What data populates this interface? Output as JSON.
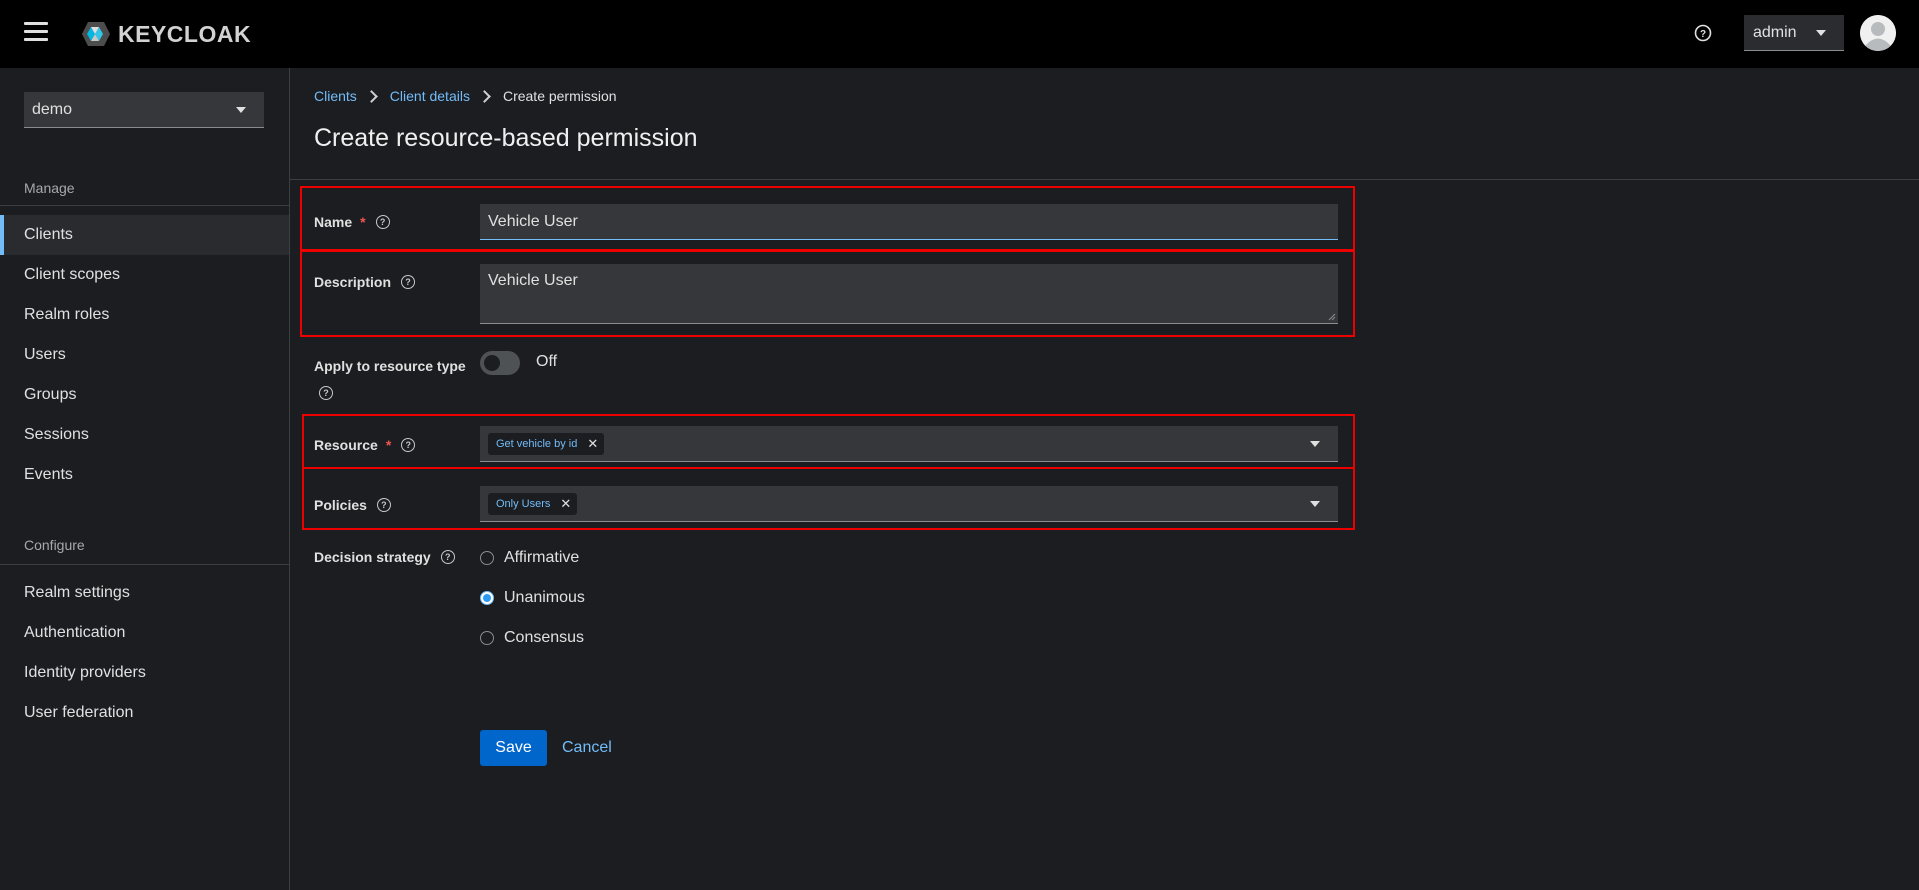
{
  "header": {
    "logo_text": "KEYCLOAK",
    "user": "admin"
  },
  "sidebar": {
    "realm": "demo",
    "manage_title": "Manage",
    "manage_items": [
      "Clients",
      "Client scopes",
      "Realm roles",
      "Users",
      "Groups",
      "Sessions",
      "Events"
    ],
    "configure_title": "Configure",
    "configure_items": [
      "Realm settings",
      "Authentication",
      "Identity providers",
      "User federation"
    ],
    "active_item": "Clients"
  },
  "breadcrumb": {
    "item1": "Clients",
    "item2": "Client details",
    "current": "Create permission"
  },
  "page": {
    "title": "Create resource-based permission"
  },
  "form": {
    "name_label": "Name",
    "name_value": "Vehicle User",
    "description_label": "Description",
    "description_value": "Vehicle User",
    "apply_label": "Apply to resource type",
    "apply_state": "Off",
    "resource_label": "Resource",
    "resource_chip": "Get vehicle by id",
    "policies_label": "Policies",
    "policies_chip": "Only Users",
    "decision_label": "Decision strategy",
    "decision_options": [
      "Affirmative",
      "Unanimous",
      "Consensus"
    ],
    "decision_selected": "Unanimous",
    "required_mark": "*",
    "save_label": "Save",
    "cancel_label": "Cancel"
  },
  "colors": {
    "accent": "#73bcf7",
    "primary_button": "#0066cc",
    "highlight": "#ee0000"
  }
}
